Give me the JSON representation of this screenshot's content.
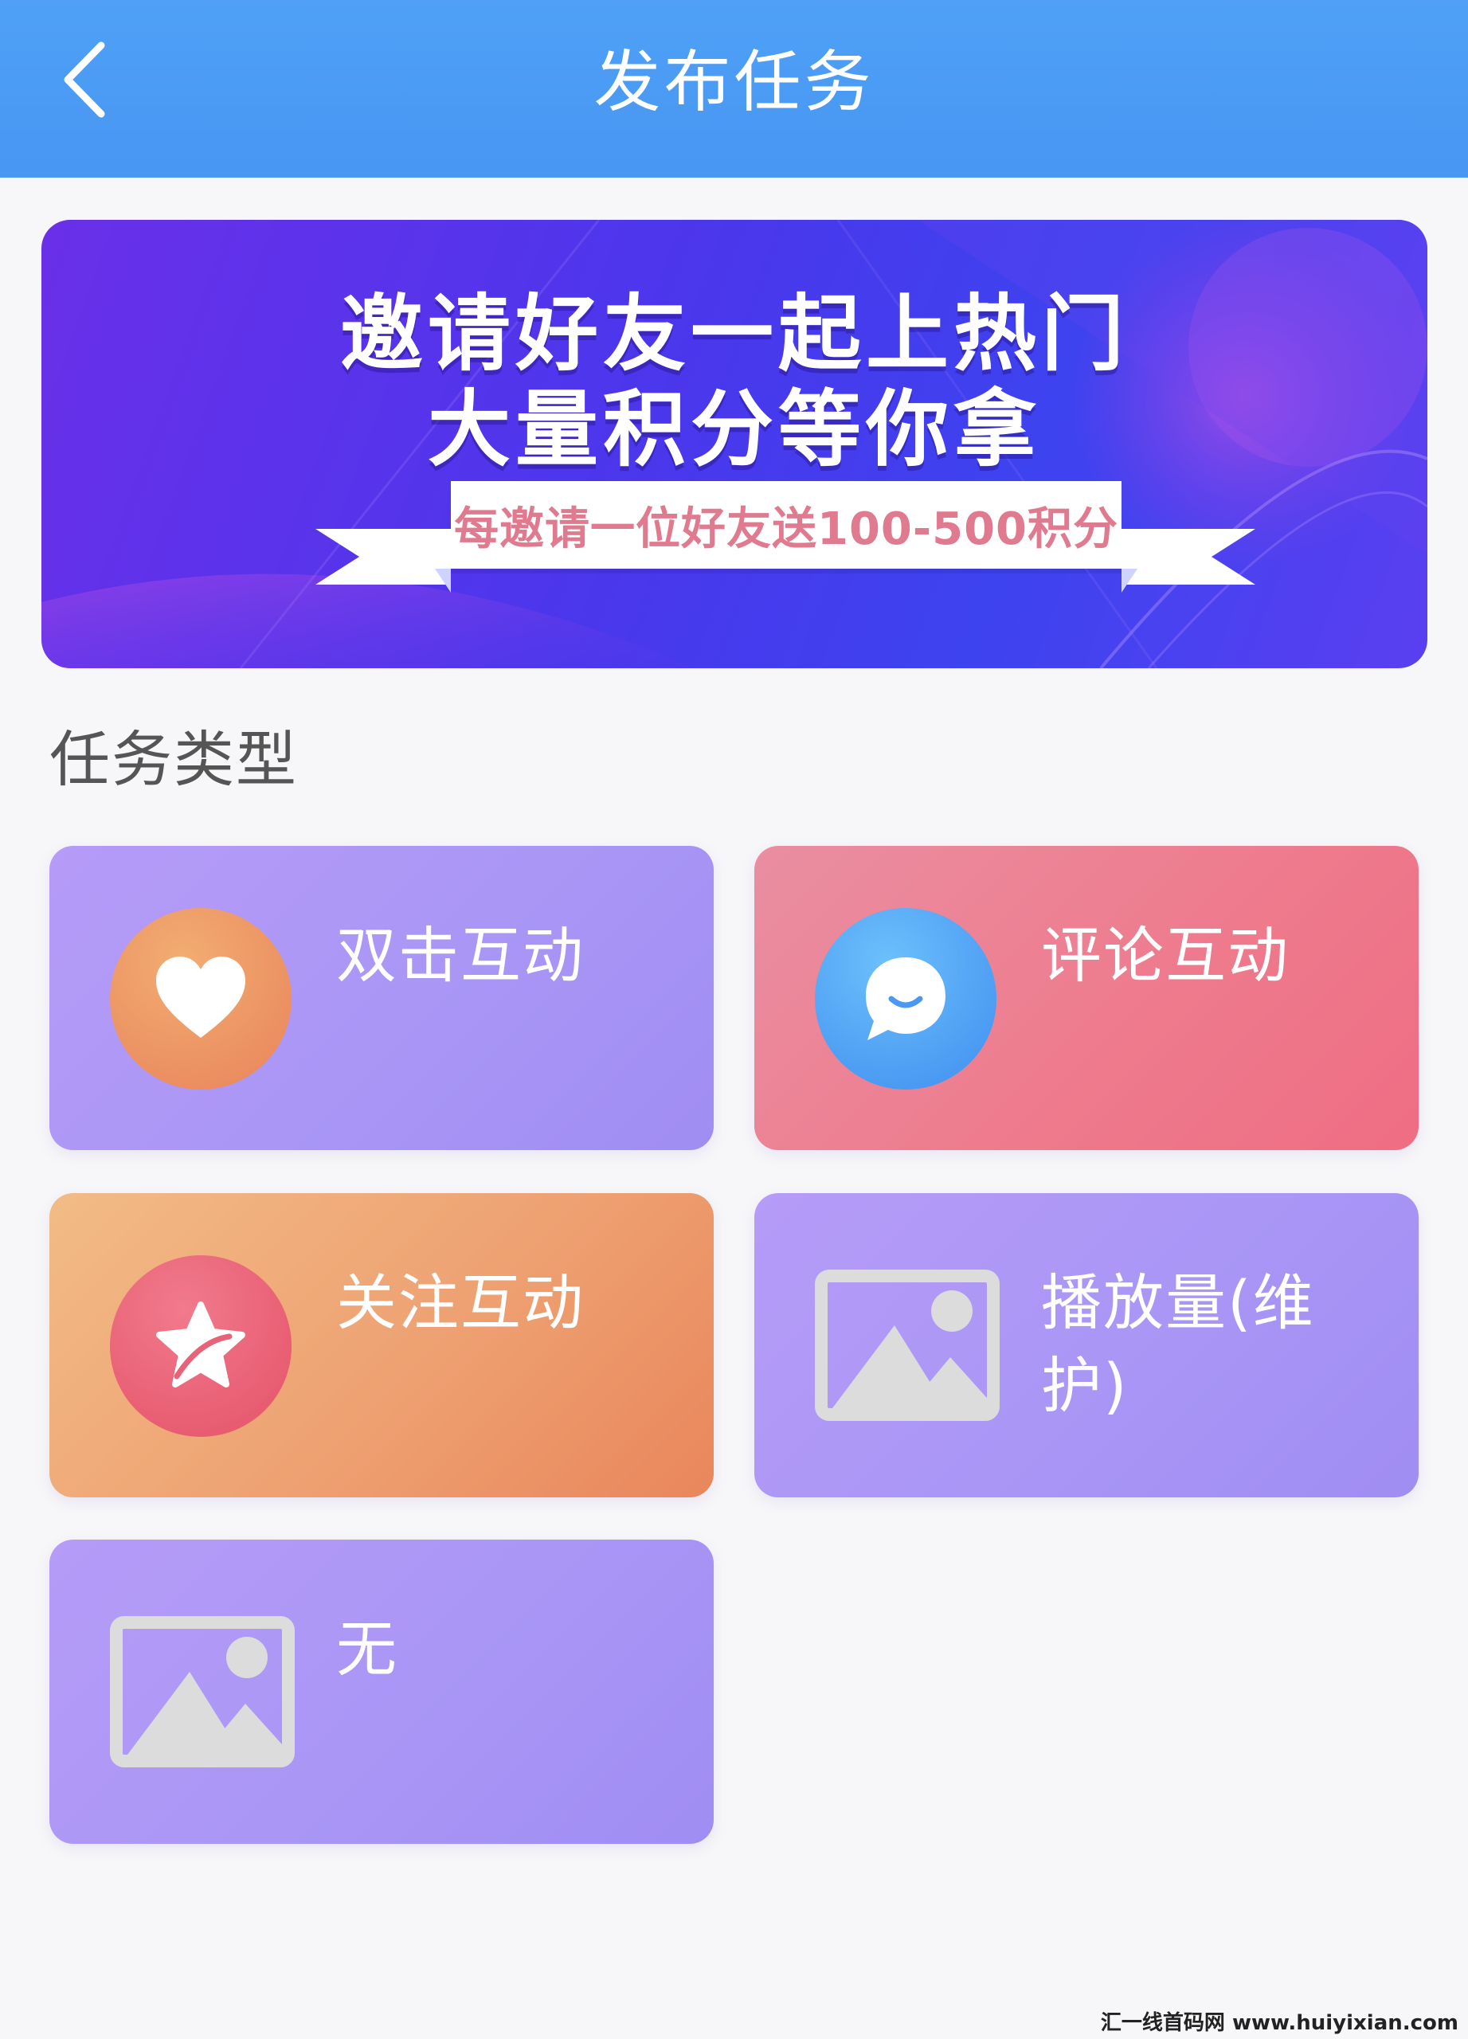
{
  "header": {
    "back_icon": "chevron-left-icon",
    "title": "发布任务"
  },
  "banner": {
    "line1": "邀请好友一起上热门",
    "line2": "大量积分等你拿",
    "ribbon_text": "每邀请一位好友送100-500积分"
  },
  "section": {
    "title": "任务类型"
  },
  "tasks": [
    {
      "label": "双击互动",
      "icon": "heart-icon",
      "color": "purple"
    },
    {
      "label": "评论互动",
      "icon": "chat-bubble-icon",
      "color": "red"
    },
    {
      "label": "关注互动",
      "icon": "star-icon",
      "color": "orange"
    },
    {
      "label": "播放量(维护)",
      "icon": "image-placeholder-icon",
      "color": "purple"
    },
    {
      "label": "无",
      "icon": "image-placeholder-icon",
      "color": "purple"
    }
  ],
  "watermark": "汇一线首码网 www.huiyixian.com"
}
